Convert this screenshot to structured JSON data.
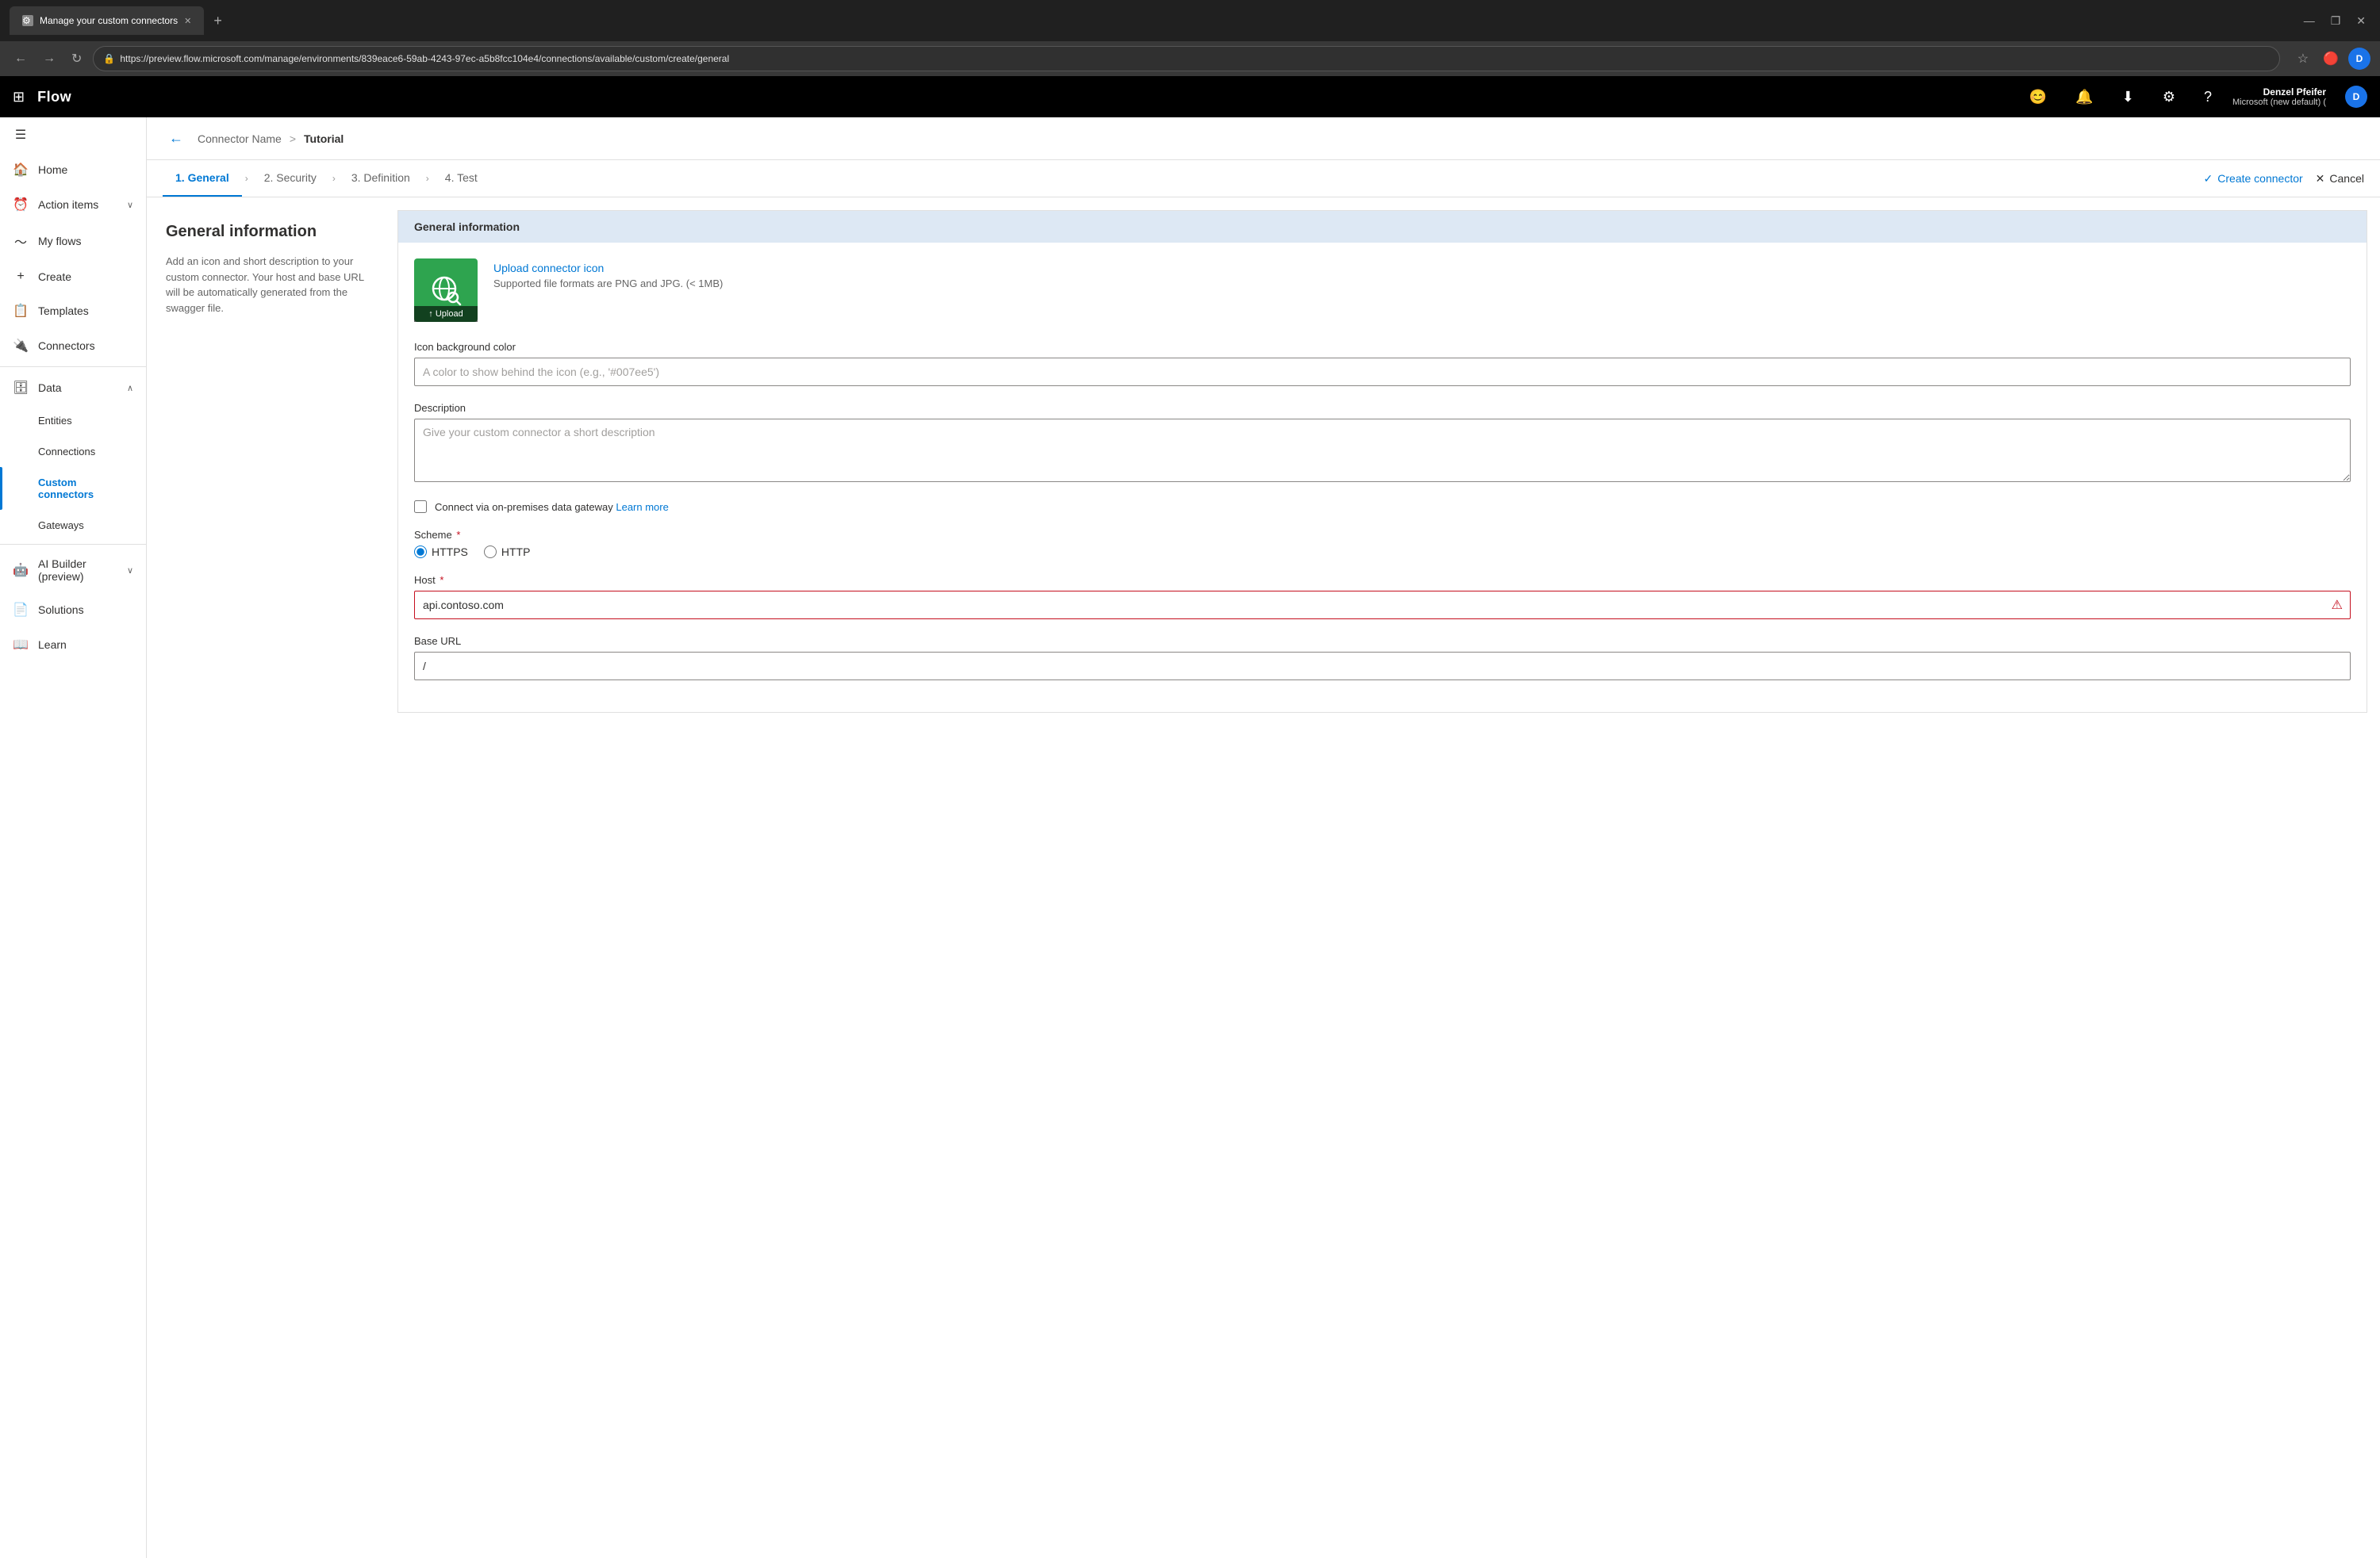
{
  "browser": {
    "tab_title": "Manage your custom connectors",
    "tab_favicon": "⚙",
    "new_tab_label": "+",
    "url": "https://preview.flow.microsoft.com/manage/environments/839eace6-59ab-4243-97ec-a5b8fcc104e4/connections/available/custom/create/general",
    "nav_back": "←",
    "nav_forward": "→",
    "nav_refresh": "↻",
    "lock_icon": "🔒",
    "star_icon": "☆",
    "extension_icon": "🔴",
    "user_initial": "D",
    "minimize": "—",
    "restore": "❐",
    "close": "✕"
  },
  "header": {
    "waffle": "⊞",
    "app_name": "Flow",
    "emoji_btn": "😊",
    "bell_btn": "🔔",
    "download_btn": "⬇",
    "settings_btn": "⚙",
    "help_btn": "?",
    "user_name": "Denzel Pfeifer",
    "user_tenant": "Microsoft (new default) (",
    "user_initial": "D"
  },
  "sidebar": {
    "hamburger": "☰",
    "items": [
      {
        "id": "home",
        "icon": "🏠",
        "label": "Home",
        "active": false,
        "expandable": false
      },
      {
        "id": "action-items",
        "icon": "⏰",
        "label": "Action items",
        "active": false,
        "expandable": true
      },
      {
        "id": "my-flows",
        "icon": "〜",
        "label": "My flows",
        "active": false,
        "expandable": false
      },
      {
        "id": "create",
        "icon": "+",
        "label": "Create",
        "active": false,
        "expandable": false
      },
      {
        "id": "templates",
        "icon": "📋",
        "label": "Templates",
        "active": false,
        "expandable": false
      },
      {
        "id": "connectors",
        "icon": "🔌",
        "label": "Connectors",
        "active": false,
        "expandable": false
      },
      {
        "id": "data",
        "icon": "🗄",
        "label": "Data",
        "active": false,
        "expandable": true
      },
      {
        "id": "entities",
        "icon": "",
        "label": "Entities",
        "active": false,
        "sub": true
      },
      {
        "id": "connections",
        "icon": "",
        "label": "Connections",
        "active": false,
        "sub": true
      },
      {
        "id": "custom-connectors",
        "icon": "",
        "label": "Custom connectors",
        "active": true,
        "sub": true
      },
      {
        "id": "gateways",
        "icon": "",
        "label": "Gateways",
        "active": false,
        "sub": true
      },
      {
        "id": "ai-builder",
        "icon": "🤖",
        "label": "AI Builder (preview)",
        "active": false,
        "expandable": true
      },
      {
        "id": "solutions",
        "icon": "📄",
        "label": "Solutions",
        "active": false,
        "expandable": false
      },
      {
        "id": "learn",
        "icon": "📖",
        "label": "Learn",
        "active": false,
        "expandable": false
      }
    ]
  },
  "breadcrumb": {
    "back_icon": "←",
    "parent": "Connector Name",
    "separator": ">",
    "current": "Tutorial"
  },
  "steps": [
    {
      "id": "general",
      "label": "1. General",
      "active": true
    },
    {
      "id": "security",
      "label": "2. Security",
      "active": false
    },
    {
      "id": "definition",
      "label": "3. Definition",
      "active": false
    },
    {
      "id": "test",
      "label": "4. Test",
      "active": false
    }
  ],
  "actions": {
    "create_connector": "Create connector",
    "create_icon": "✓",
    "cancel": "Cancel",
    "cancel_icon": "✕"
  },
  "left_panel": {
    "title": "General information",
    "description": "Add an icon and short description to your custom connector. Your host and base URL will be automatically generated from the swagger file."
  },
  "form": {
    "section_title": "General information",
    "upload_icon_label": "Upload connector icon",
    "upload_hint": "Supported file formats are PNG and JPG. (< 1MB)",
    "upload_btn_label": "↑ Upload",
    "icon_bg_color_label": "Icon background color",
    "icon_bg_color_placeholder": "A color to show behind the icon (e.g., '#007ee5')",
    "description_label": "Description",
    "description_placeholder": "Give your custom connector a short description",
    "gateway_checkbox_label": "Connect via on-premises data gateway",
    "learn_more": "Learn more",
    "scheme_label": "Scheme",
    "scheme_required": "*",
    "scheme_options": [
      {
        "id": "https",
        "label": "HTTPS",
        "selected": true
      },
      {
        "id": "http",
        "label": "HTTP",
        "selected": false
      }
    ],
    "host_label": "Host",
    "host_required": "*",
    "host_value": "api.contoso.com",
    "host_error": true,
    "host_error_icon": "⚠",
    "base_url_label": "Base URL",
    "base_url_value": "/"
  }
}
